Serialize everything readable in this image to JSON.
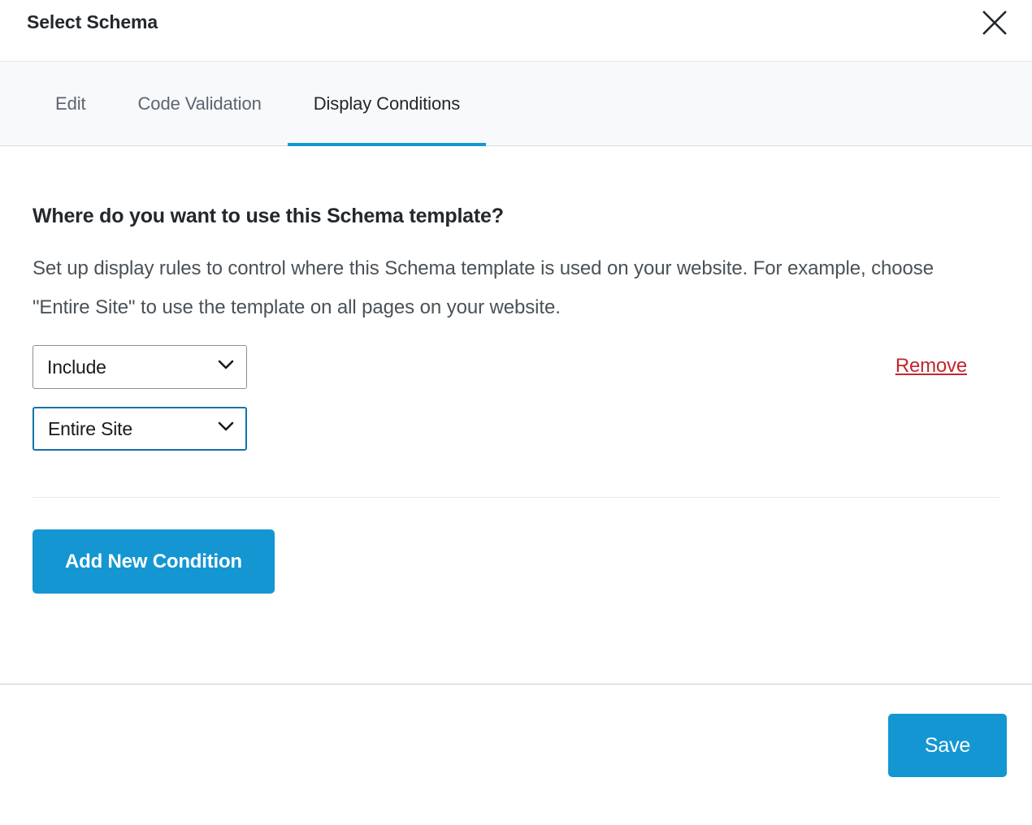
{
  "modal": {
    "title": "Select Schema",
    "close_icon": "close-icon"
  },
  "tabs": [
    {
      "label": "Edit",
      "active": false
    },
    {
      "label": "Code Validation",
      "active": false
    },
    {
      "label": "Display Conditions",
      "active": true
    }
  ],
  "main": {
    "heading": "Where do you want to use this Schema template?",
    "description": "Set up display rules to control where this Schema template is used on your website. For example, choose \"Entire Site\" to use the template on all pages on your website."
  },
  "condition": {
    "inclusion_select": {
      "value": "Include",
      "icon": "chevron-down-icon"
    },
    "scope_select": {
      "value": "Entire Site",
      "icon": "chevron-down-icon"
    },
    "remove_label": "Remove"
  },
  "actions": {
    "add_condition_label": "Add New Condition",
    "save_label": "Save"
  },
  "colors": {
    "accent_blue": "#1496d2",
    "remove_red": "#c1272d",
    "focus_border": "#1273a8",
    "tab_bar_bg": "#f8f9fa"
  }
}
